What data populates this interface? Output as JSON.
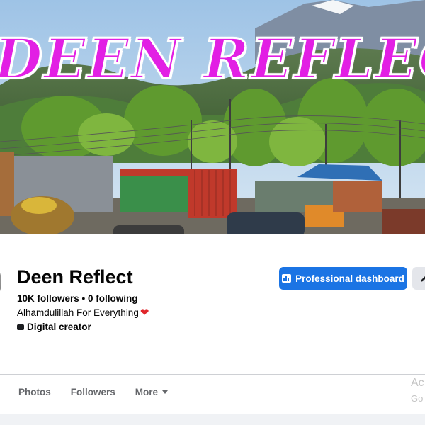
{
  "cover": {
    "title": "DEEN REFLECT"
  },
  "profile": {
    "name": "Deen Reflect",
    "stats": "10K followers • 0 following",
    "bio": "Alhamdulillah For Everything",
    "bio_emoji": "❤",
    "category": "Digital creator"
  },
  "actions": {
    "dashboard_label": "Professional dashboard"
  },
  "tabs": [
    {
      "label": "Photos"
    },
    {
      "label": "Followers"
    },
    {
      "label": "More"
    }
  ],
  "watermark": {
    "line1": "Ac",
    "line2": "Go"
  },
  "colors": {
    "accent": "#1b74e4",
    "cover_title": "#e21fe4",
    "heart": "#e0262b"
  }
}
